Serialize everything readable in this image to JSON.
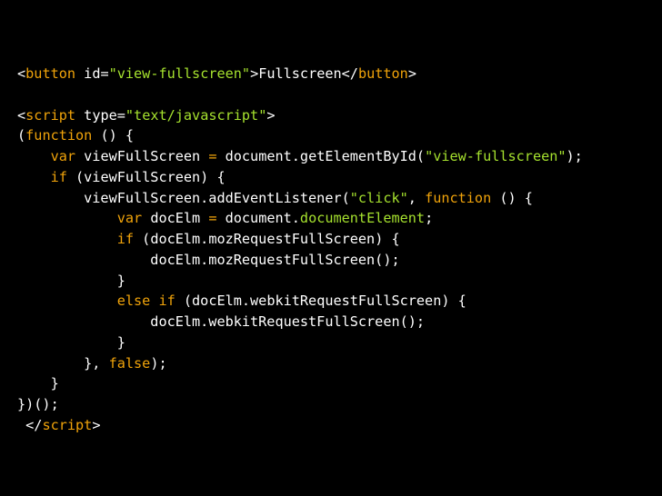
{
  "colors": {
    "background": "#000000",
    "plain": "#ffffff",
    "keyword": "#f0a30a",
    "string": "#a6e22e"
  },
  "code_lines": [
    [
      [
        "plain",
        "<"
      ],
      [
        "keyword",
        "button"
      ],
      [
        "plain",
        " id="
      ],
      [
        "string",
        "\"view-fullscreen\""
      ],
      [
        "plain",
        ">Fullscreen</"
      ],
      [
        "keyword",
        "button"
      ],
      [
        "plain",
        ">"
      ]
    ],
    [],
    [
      [
        "plain",
        "<"
      ],
      [
        "keyword",
        "script"
      ],
      [
        "plain",
        " type="
      ],
      [
        "string",
        "\"text/javascript\""
      ],
      [
        "plain",
        ">"
      ]
    ],
    [
      [
        "plain",
        "("
      ],
      [
        "keyword",
        "function"
      ],
      [
        "plain",
        " () {"
      ]
    ],
    [
      [
        "plain",
        "    "
      ],
      [
        "keyword",
        "var"
      ],
      [
        "plain",
        " viewFullScreen "
      ],
      [
        "keyword",
        "="
      ],
      [
        "plain",
        " document.getElementById("
      ],
      [
        "string",
        "\"view-fullscreen\""
      ],
      [
        "plain",
        ");"
      ]
    ],
    [
      [
        "plain",
        "    "
      ],
      [
        "keyword",
        "if"
      ],
      [
        "plain",
        " (viewFullScreen) {"
      ]
    ],
    [
      [
        "plain",
        "        viewFullScreen.addEventListener("
      ],
      [
        "string",
        "\"click\""
      ],
      [
        "plain",
        ", "
      ],
      [
        "keyword",
        "function"
      ],
      [
        "plain",
        " () {"
      ]
    ],
    [
      [
        "plain",
        "            "
      ],
      [
        "keyword",
        "var"
      ],
      [
        "plain",
        " docElm "
      ],
      [
        "keyword",
        "="
      ],
      [
        "plain",
        " document."
      ],
      [
        "string",
        "documentElement"
      ],
      [
        "plain",
        ";"
      ]
    ],
    [
      [
        "plain",
        "            "
      ],
      [
        "keyword",
        "if"
      ],
      [
        "plain",
        " (docElm.mozRequestFullScreen) {"
      ]
    ],
    [
      [
        "plain",
        "                docElm.mozRequestFullScreen();"
      ]
    ],
    [
      [
        "plain",
        "            }"
      ]
    ],
    [
      [
        "plain",
        "            "
      ],
      [
        "keyword",
        "else if"
      ],
      [
        "plain",
        " (docElm.webkitRequestFullScreen) {"
      ]
    ],
    [
      [
        "plain",
        "                docElm.webkitRequestFullScreen();"
      ]
    ],
    [
      [
        "plain",
        "            }"
      ]
    ],
    [
      [
        "plain",
        "        }, "
      ],
      [
        "keyword",
        "false"
      ],
      [
        "plain",
        ");"
      ]
    ],
    [
      [
        "plain",
        "    }"
      ]
    ],
    [
      [
        "plain",
        "})();"
      ]
    ],
    [
      [
        "plain",
        " </"
      ],
      [
        "keyword",
        "script"
      ],
      [
        "plain",
        ">"
      ]
    ]
  ]
}
